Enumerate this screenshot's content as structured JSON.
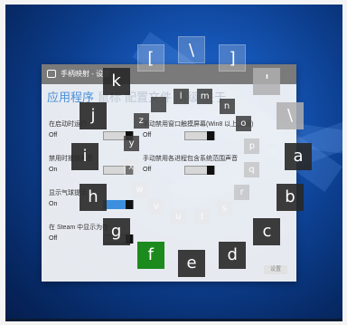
{
  "window": {
    "title": "手柄映射 - 设置",
    "icon": "gamepad-icon"
  },
  "tabs": [
    "应用程序",
    "鼠标",
    "配置文件",
    "高级",
    "关于"
  ],
  "active_tab": 0,
  "options": [
    {
      "label": "在启动时运行",
      "value": "Off",
      "state": "off"
    },
    {
      "label": "禁用时播放声音",
      "value": "On",
      "state": "off"
    },
    {
      "label": "显示气球提示",
      "value": "On",
      "state": "on"
    },
    {
      "label": "在 Steam 中显示为在",
      "value": "Off",
      "state": "off"
    }
  ],
  "right_options": [
    {
      "label": "手动禁用窗口触摸屏幕(Win8 以上,上设)",
      "value": "Off"
    },
    {
      "label": "手动禁用各进程包含系统范围声音",
      "value": "Off"
    }
  ],
  "hidden_button": "设置",
  "wheel": {
    "outer_keys": [
      "[",
      "\\",
      "]",
      "'",
      "\\",
      "a",
      "b",
      "c",
      "d",
      "e",
      "f",
      "g",
      "h",
      "i",
      "j",
      "k"
    ],
    "inner_keys": [
      "l",
      "m",
      "n",
      "o",
      "p",
      "q",
      "r",
      "s",
      "t",
      "u",
      "v",
      "w",
      "x",
      "y",
      "z",
      ""
    ],
    "highlighted_key": "f",
    "highlight_color": "#1c8a1c"
  }
}
